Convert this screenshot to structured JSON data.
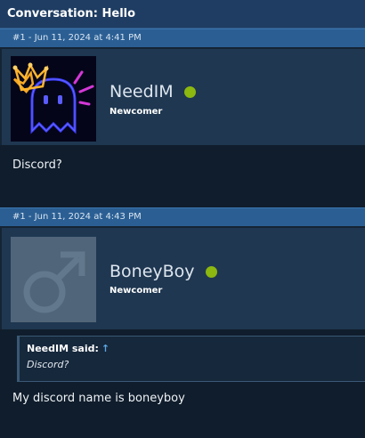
{
  "thread": {
    "title": "Conversation: Hello"
  },
  "posts": [
    {
      "header": "#1 - Jun 11, 2024 at 4:41 PM",
      "username": "NeedIM",
      "user_title": "Newcomer",
      "online": true,
      "avatar": "neon-ghost-crown-avatar",
      "message": "Discord?"
    },
    {
      "header": "#1 - Jun 11, 2024 at 4:43 PM",
      "username": "BoneyBoy",
      "user_title": "Newcomer",
      "online": true,
      "avatar": "default-male-avatar",
      "quote": {
        "author": "NeedIM said:",
        "arrow": "↑",
        "text": "Discord?"
      },
      "message": "My discord name is boneyboy"
    }
  ],
  "colors": {
    "online": "#8cb80f",
    "header": "#2b5f94",
    "background": "#152435"
  }
}
